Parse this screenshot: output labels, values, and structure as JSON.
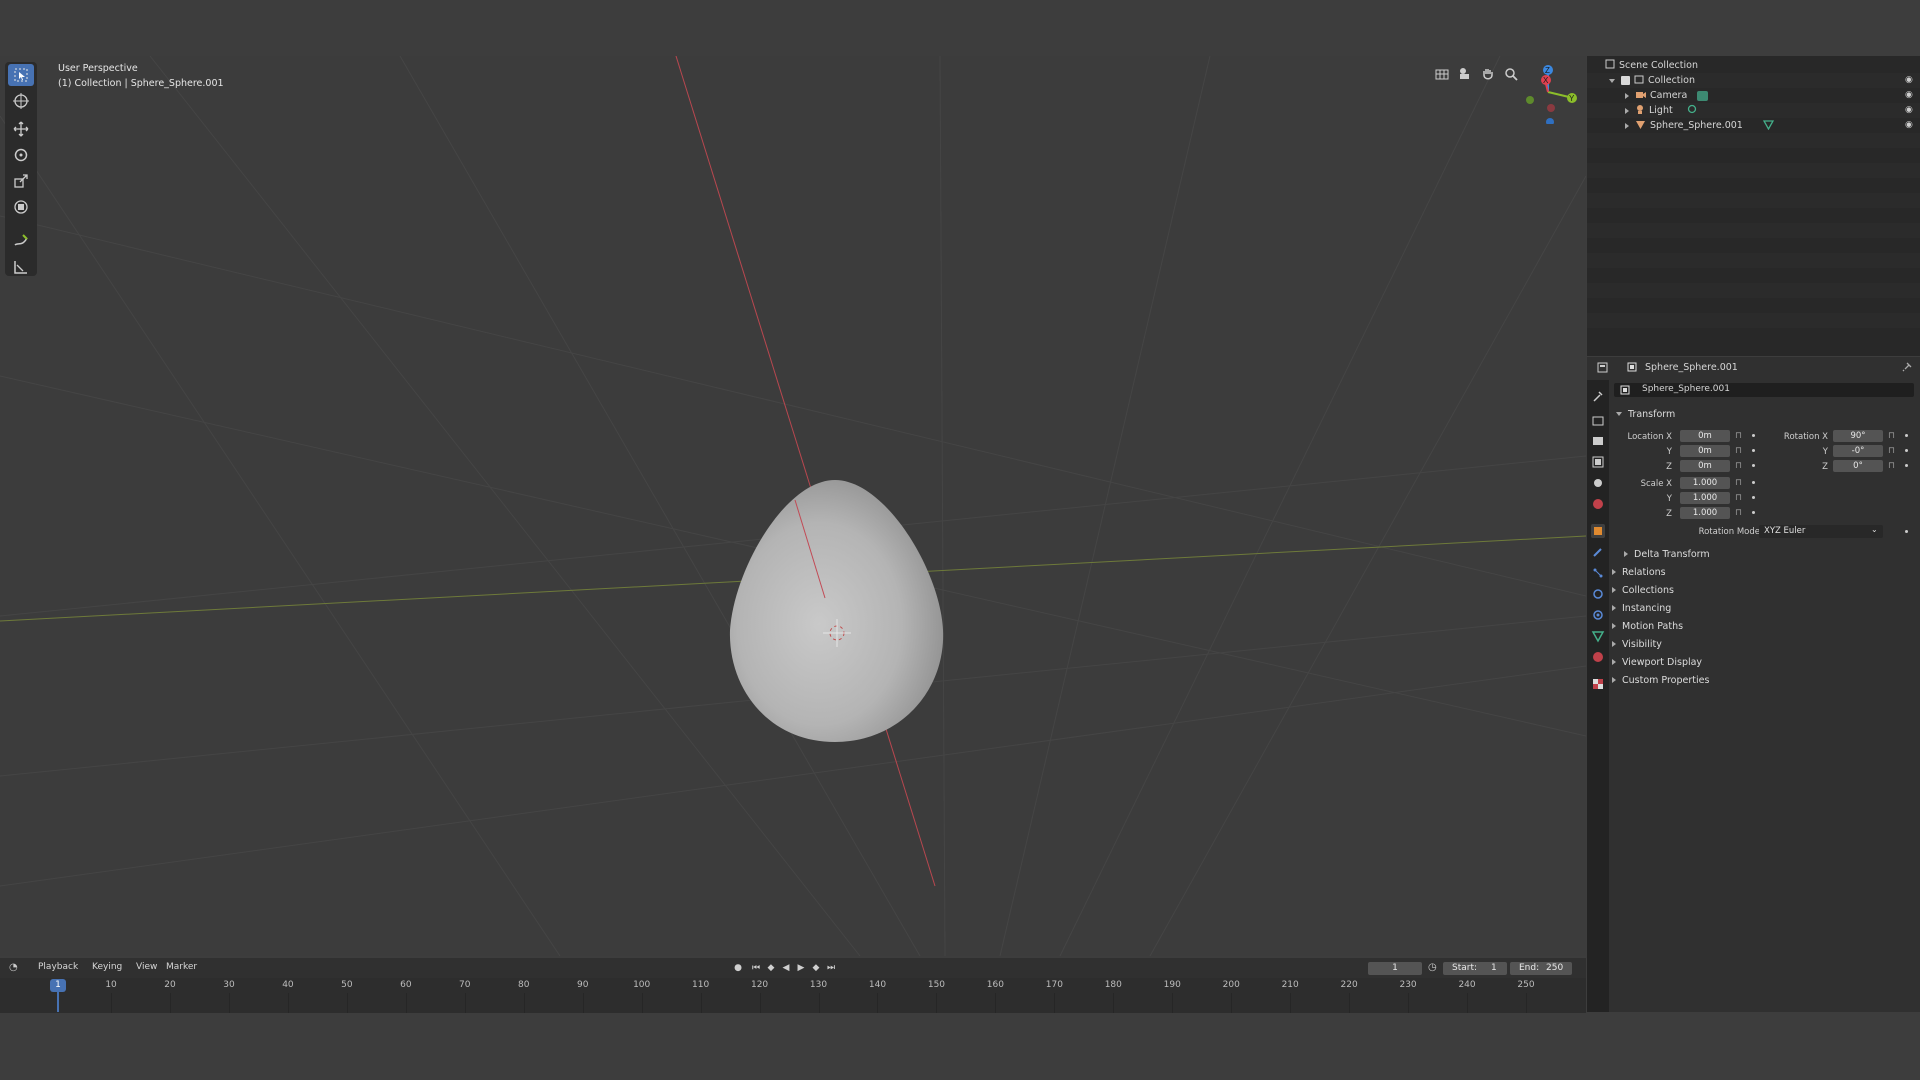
{
  "viewport": {
    "mode_label": "User Perspective",
    "context_label": "(1) Collection | Sphere_Sphere.001",
    "tools": [
      "select-box-icon",
      "cursor-icon",
      "move-icon",
      "rotate-icon",
      "scale-icon",
      "transform-icon",
      "annotate-icon",
      "measure-icon"
    ],
    "header_icons": [
      "grid-icon",
      "camera-view-icon",
      "pan-hand-icon",
      "zoom-icon"
    ],
    "gizmo_axes": {
      "x": "X",
      "y": "Y",
      "z": "Z"
    }
  },
  "outliner": {
    "root": "Scene Collection",
    "collection": "Collection",
    "items": [
      {
        "name": "Camera",
        "icon": "camera-icon"
      },
      {
        "name": "Light",
        "icon": "light-icon"
      },
      {
        "name": "Sphere_Sphere.001",
        "icon": "mesh-icon"
      }
    ]
  },
  "properties": {
    "header_object": "Sphere_Sphere.001",
    "object_name": "Sphere_Sphere.001",
    "transform_title": "Transform",
    "location_label": "Location X",
    "location": [
      "0m",
      "0m",
      "0m"
    ],
    "rotation_label": "Rotation X",
    "rotation": [
      "90°",
      "-0°",
      "0°"
    ],
    "scale_label": "Scale X",
    "scale": [
      "1.000",
      "1.000",
      "1.000"
    ],
    "axis_y": "Y",
    "axis_z": "Z",
    "rotation_mode_label": "Rotation Mode",
    "rotation_mode_value": "XYZ Euler",
    "delta_transform": "Delta Transform",
    "panels": [
      "Relations",
      "Collections",
      "Instancing",
      "Motion Paths",
      "Visibility",
      "Viewport Display",
      "Custom Properties"
    ]
  },
  "timeline": {
    "menus": [
      "Playback",
      "Keying",
      "View",
      "Marker"
    ],
    "current_frame": "1",
    "start_label": "Start:",
    "start": "1",
    "end_label": "End:",
    "end": "250",
    "ticks": [
      "10",
      "20",
      "30",
      "40",
      "50",
      "60",
      "70",
      "80",
      "90",
      "100",
      "110",
      "120",
      "130",
      "140",
      "150",
      "160",
      "170",
      "180",
      "190",
      "200",
      "210",
      "220",
      "230",
      "240",
      "250"
    ],
    "playhead": "1"
  },
  "colors": {
    "accent": "#4772b3",
    "x_axis": "#e04050",
    "y_axis": "#8cbe2a",
    "z_axis": "#3b88e0"
  }
}
